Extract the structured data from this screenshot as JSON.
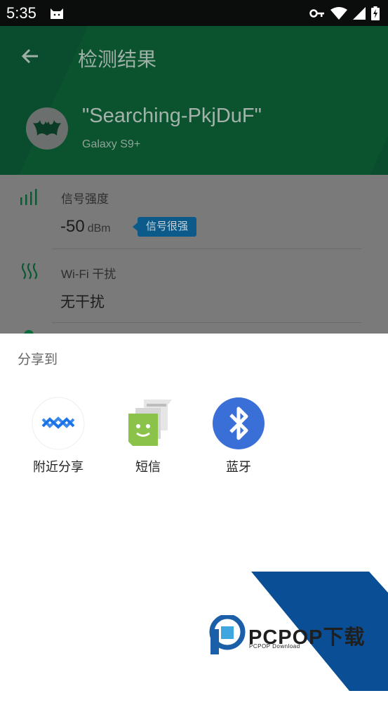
{
  "status_bar": {
    "time": "5:35",
    "icons": [
      "cat-icon",
      "key-icon",
      "wifi-icon",
      "cell-signal-icon",
      "battery-charging-icon"
    ]
  },
  "app_bar": {
    "title": "检测结果",
    "network_name": "\"Searching-PkjDuF\"",
    "device_name": "Galaxy S9+"
  },
  "metrics": {
    "signal": {
      "label": "信号强度",
      "value": "-50",
      "unit": "dBm",
      "badge": "信号很强"
    },
    "wifi_interference": {
      "label": "Wi-Fi 干扰",
      "value": "无干扰"
    }
  },
  "share_sheet": {
    "title": "分享到",
    "targets": [
      {
        "label": "附近分享",
        "icon": "nearby-share-icon"
      },
      {
        "label": "短信",
        "icon": "messages-icon"
      },
      {
        "label": "蓝牙",
        "icon": "bluetooth-icon"
      }
    ]
  },
  "watermark": {
    "brand": "PCPOP下载",
    "sub": "PCPOP Download"
  },
  "colors": {
    "app_bar": "#0a4d2e",
    "scrim": "#7a7a7a",
    "badge": "#0b5a8a",
    "bluetooth": "#3a6fd8",
    "messages": "#8bc34a",
    "watermark_blue": "#0a4f96"
  }
}
